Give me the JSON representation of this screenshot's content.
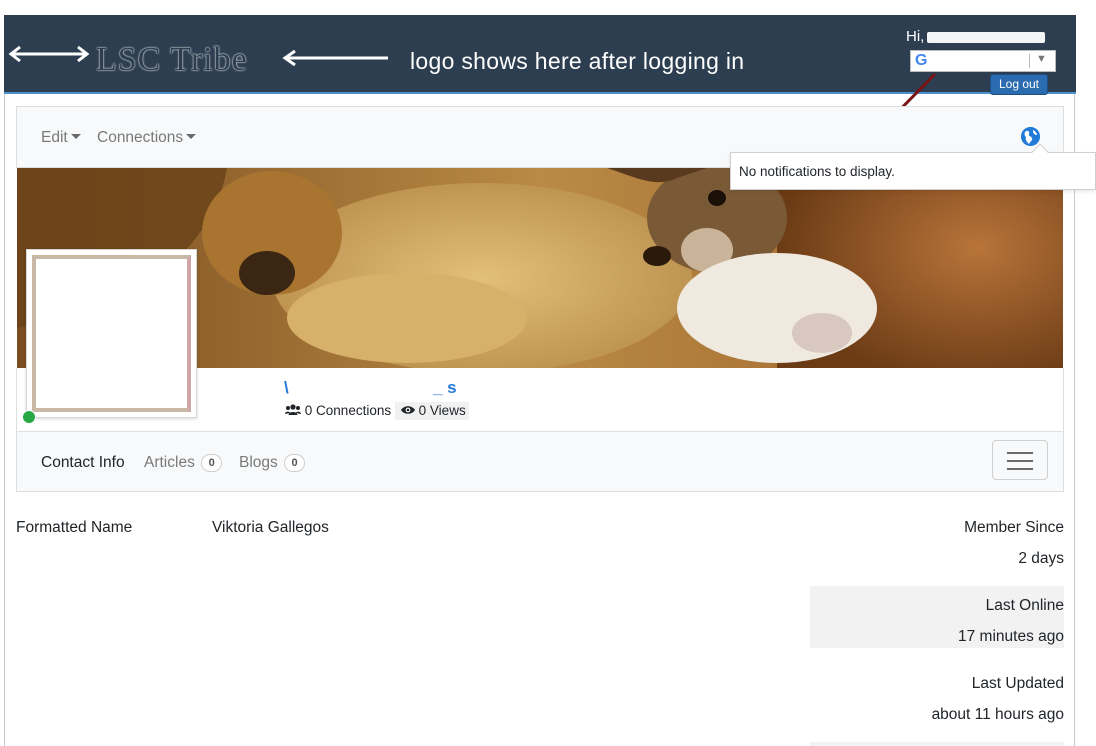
{
  "header": {
    "logo_text": "LSC Tribe",
    "annotation": "logo shows here after logging in",
    "greeting": "Hi,",
    "language_select_icon": "google-g-icon",
    "logout_label": "Log out",
    "background_color": "#2c3e50"
  },
  "nav": {
    "edit_label": "Edit",
    "connections_label": "Connections",
    "notifications_icon": "globe-icon"
  },
  "notifications": {
    "empty_text": "No notifications to display."
  },
  "profile": {
    "name": "\\",
    "name_tail": "_ s",
    "connections_count": "0",
    "connections_label": "Connections",
    "views_count": "0",
    "views_label": "Views",
    "online_status_color": "#28a745"
  },
  "tabs": [
    {
      "label": "Contact Info",
      "count": ""
    },
    {
      "label": "Articles",
      "count": "0"
    },
    {
      "label": "Blogs",
      "count": "0"
    }
  ],
  "details": {
    "formatted_name_label": "Formatted Name",
    "formatted_name_value": "Viktoria Gallegos",
    "member_since_label": "Member Since",
    "member_since_value": "2 days",
    "last_online_label": "Last Online",
    "last_online_value": "17 minutes ago",
    "last_updated_label": "Last Updated",
    "last_updated_value": "about 11 hours ago"
  }
}
